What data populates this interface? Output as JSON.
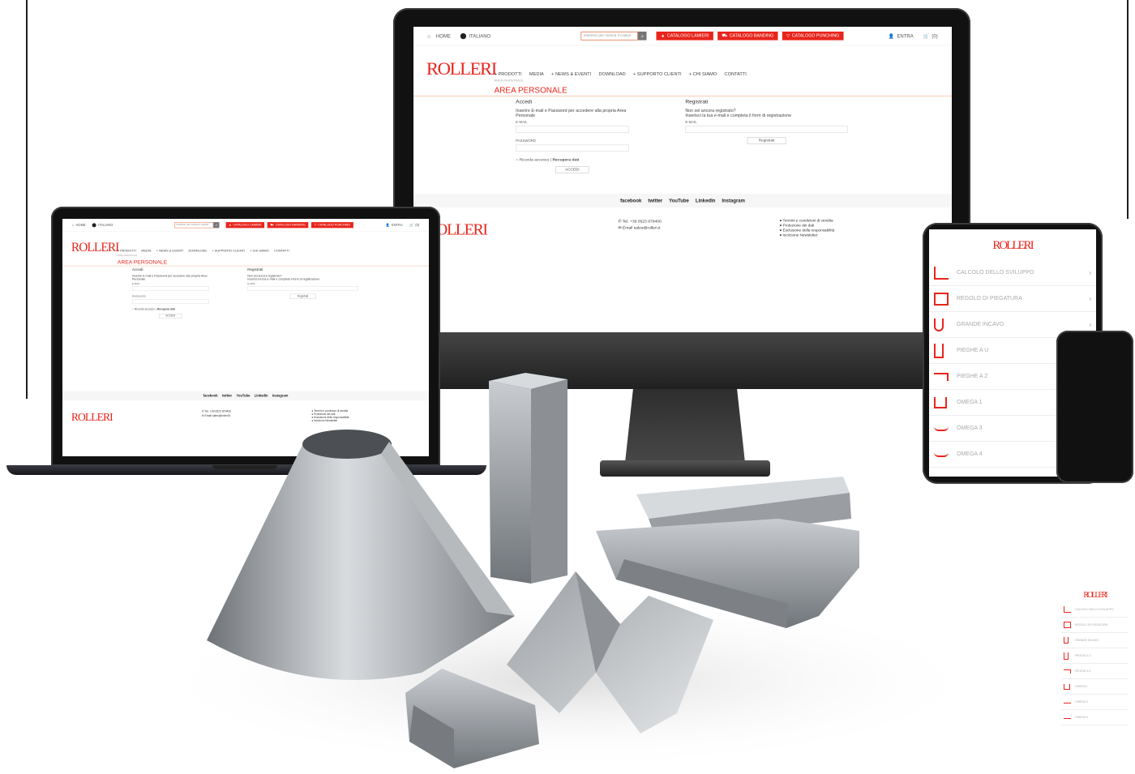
{
  "site": {
    "topbar": {
      "home": "HOME",
      "language": "ITALIANO",
      "search_placeholder": "Inserisci per ricerca il codice",
      "catalogs": [
        "CATALOGO LAMIERI",
        "CATALOGO BANDING",
        "CATALOGO PUNCHING"
      ],
      "account": "ENTRA",
      "cart_count": "(0)"
    },
    "logo": "ROLLERI",
    "nav": [
      "+ PRODOTTI",
      "MEDIA",
      "+ NEWS & EVENTI",
      "DOWNLOAD",
      "+ SUPPORTO CLIENTI",
      "+ CHI SIAMO",
      "CONTATTI"
    ],
    "breadcrumb": "AREA PERSONALE",
    "page_title": "AREA PERSONALE",
    "login": {
      "title": "Accedi",
      "intro": "Inserire E-mail e Password per accedere alla propria Area Personale",
      "email_label": "E-MAIL",
      "password_label": "PASSWORD",
      "remember": "Ricorda accesso",
      "recover": "Recupera dati",
      "submit": "ACCEDI"
    },
    "register": {
      "title": "Registrati",
      "line1": "Non sei ancora registrato?",
      "line2": "Inserisci la tua e-mail e completa il form di registrazione",
      "email_label": "E-MAIL",
      "submit": "Registrati"
    },
    "social": [
      "facebook",
      "twitter",
      "YouTube",
      "LinkedIn",
      "Instagram"
    ],
    "footer": {
      "logo": "ROLLERI",
      "phone": "Tel. +39 0523 879400",
      "email": "Email sales@rolleri.it",
      "links": [
        "Termini e condizioni di vendita",
        "Protezione dei dati",
        "Esclusione della responsabilità",
        "Iscrizione Newsletter"
      ]
    }
  },
  "app": {
    "logo": "ROLLERI",
    "items": [
      "CALCOLO DELLO SVILUPPO",
      "REGOLO DI PIEGATURA",
      "GRANDE INCAVO",
      "PIEGHE A U",
      "PIEGHE A Z",
      "OMEGA 1",
      "OMEGA 3",
      "OMEGA 4"
    ]
  },
  "colors": {
    "brand_red": "#e8251c",
    "accent_orange": "#f0b28f",
    "device_black": "#111111",
    "steel": "#a8acb0"
  }
}
